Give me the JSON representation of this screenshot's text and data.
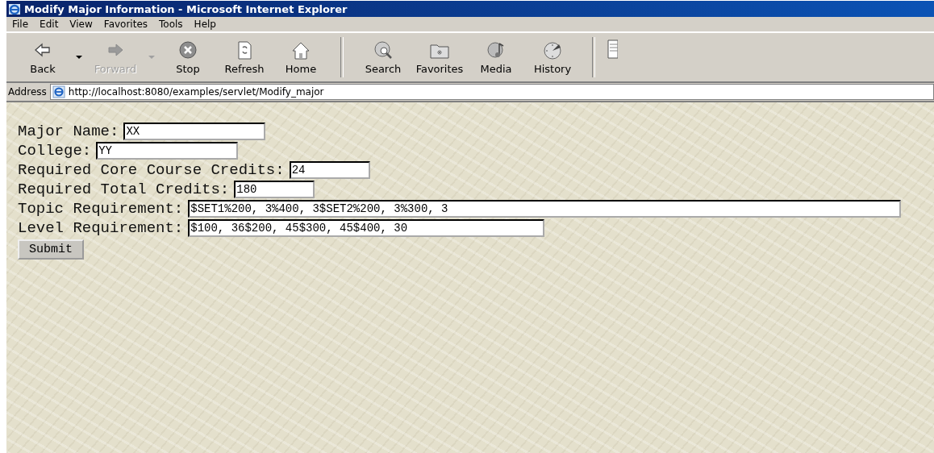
{
  "window": {
    "title": "Modify Major Information - Microsoft Internet Explorer"
  },
  "menu": [
    "File",
    "Edit",
    "View",
    "Favorites",
    "Tools",
    "Help"
  ],
  "toolbar": [
    {
      "kind": "button",
      "label": "Back",
      "disabled": false
    },
    {
      "kind": "dropdown",
      "disabled": false
    },
    {
      "kind": "button",
      "label": "Forward",
      "disabled": true
    },
    {
      "kind": "dropdown",
      "disabled": true
    },
    {
      "kind": "button",
      "label": "Stop",
      "disabled": false
    },
    {
      "kind": "button",
      "label": "Refresh",
      "disabled": false
    },
    {
      "kind": "button",
      "label": "Home",
      "disabled": false
    },
    {
      "kind": "separator"
    },
    {
      "kind": "button",
      "label": "Search",
      "disabled": false
    },
    {
      "kind": "button",
      "label": "Favorites",
      "disabled": false
    },
    {
      "kind": "button",
      "label": "Media",
      "disabled": false
    },
    {
      "kind": "button",
      "label": "History",
      "disabled": false
    },
    {
      "kind": "separator"
    },
    {
      "kind": "partial"
    }
  ],
  "address": {
    "label": "Address",
    "value": "http://localhost:8080/examples/servlet/Modify_major"
  },
  "form": {
    "fields": [
      {
        "label": "Major Name:",
        "value": "XX"
      },
      {
        "label": "College:",
        "value": "YY"
      },
      {
        "label": "Required Core Course Credits:",
        "value": "24"
      },
      {
        "label": "Required Total Credits:",
        "value": "180"
      },
      {
        "label": "Topic Requirement:",
        "value": "$SET1%200, 3%400, 3$SET2%200, 3%300, 3"
      },
      {
        "label": "Level Requirement:",
        "value": "$100, 36$200, 45$300, 45$400, 30"
      }
    ],
    "submit": "Submit"
  }
}
